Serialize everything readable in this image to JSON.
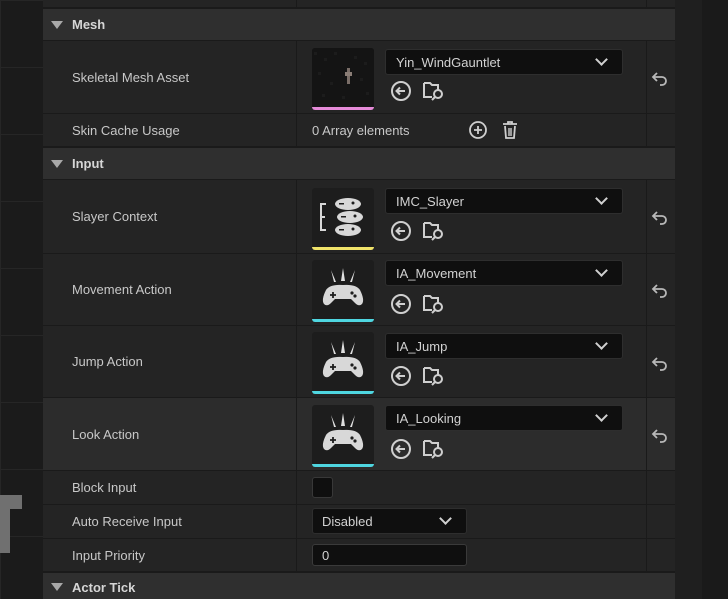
{
  "sections": {
    "mesh": "Mesh",
    "input": "Input",
    "actor_tick": "Actor Tick"
  },
  "rows": {
    "skeletal_mesh_asset": {
      "label": "Skeletal Mesh Asset",
      "value": "Yin_WindGauntlet"
    },
    "skin_cache_usage": {
      "label": "Skin Cache Usage",
      "value": "0 Array elements"
    },
    "slayer_context": {
      "label": "Slayer Context",
      "value": "IMC_Slayer"
    },
    "movement_action": {
      "label": "Movement Action",
      "value": "IA_Movement"
    },
    "jump_action": {
      "label": "Jump Action",
      "value": "IA_Jump"
    },
    "look_action": {
      "label": "Look Action",
      "value": "IA_Looking"
    },
    "block_input": {
      "label": "Block Input"
    },
    "auto_receive_input": {
      "label": "Auto Receive Input",
      "value": "Disabled"
    },
    "input_priority": {
      "label": "Input Priority",
      "value": "0"
    }
  },
  "colors": {
    "mesh_bar": "#e58ad8",
    "context_bar": "#f0e36a",
    "action_bar": "#4fd6e0"
  },
  "icons": {
    "section_toggle": "triangle-down-icon",
    "use_selected": "arrow-left-circle-icon",
    "browse": "folder-search-icon",
    "reset": "reset-arrow-icon",
    "add": "plus-circle-icon",
    "delete": "trash-icon",
    "dropdown": "chevron-down-icon"
  }
}
